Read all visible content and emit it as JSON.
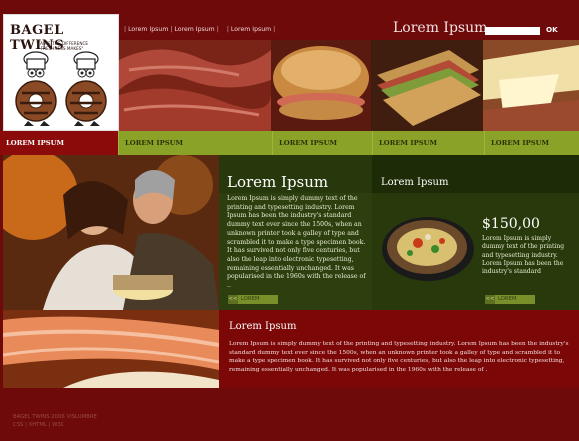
{
  "logo": {
    "title": "BAGEL TWINS",
    "tagline": "\"TASTE THE DIFFERENCE FRESHNESS MAKES\""
  },
  "nav": {
    "items": [
      "Lorem Ipsum",
      "Lorem Ipsum",
      "Lorem Ipsum"
    ],
    "separator": "|"
  },
  "header": {
    "title": "Lorem Ipsum",
    "search_placeholder": "",
    "ok_label": "OK"
  },
  "tabs": [
    {
      "label": "LOREM IPSUM",
      "active": true
    },
    {
      "label": "LOREM IPSUM",
      "active": false
    },
    {
      "label": "LOREM IPSUM",
      "active": false
    },
    {
      "label": "LOREM IPSUM",
      "active": false
    },
    {
      "label": "LOREM IPSUM",
      "active": false
    }
  ],
  "mid_panel": {
    "title": "Lorem Ipsum",
    "text": "Lorem Ipsum is simply dummy text of the printing and typesetting industry. Lorem Ipsum has been the industry's standard dummy text ever since the 1500s, when an unknown printer took a galley of type and scrambled it to make a type specimen book. It has survived not only five centuries, but also the leap into electronic typesetting, remaining essentially unchanged. It was popularised in the 1960s with the release of ..",
    "more_label": "LOREM",
    "more_arrow": "<<"
  },
  "right_panel": {
    "title": "Lorem Ipsum",
    "price": "$150,00",
    "text": "Lorem Ipsum is simply dummy text of the printing and typesetting industry. Lorem Ipsum has been the industry's standard",
    "more_label": "LOREM",
    "more_arrow": "<<"
  },
  "bottom_panel": {
    "title": "Lorem Ipsum",
    "text": "Lorem Ipsum is simply dummy text of the printing and typesetting industry. Lorem Ipsum has been the industry's standard dummy text ever since the 1500s, when an unknown printer took a galley of type and scrambled it to make a type specimen book. It has survived not only five centuries, but also the leap into electronic typesetting, remaining essentially unchanged. It was popularised in the 1960s with the release of ."
  },
  "footer": {
    "line1": "BAGEL TWINS 2006 VISLUMBRE",
    "line2": "CSS | XHTML | W3C"
  },
  "colors": {
    "background": "#6e0a0a",
    "green_bar": "#8aa227",
    "dark_green": "#27380c",
    "active_tab": "#8b0a0a"
  }
}
